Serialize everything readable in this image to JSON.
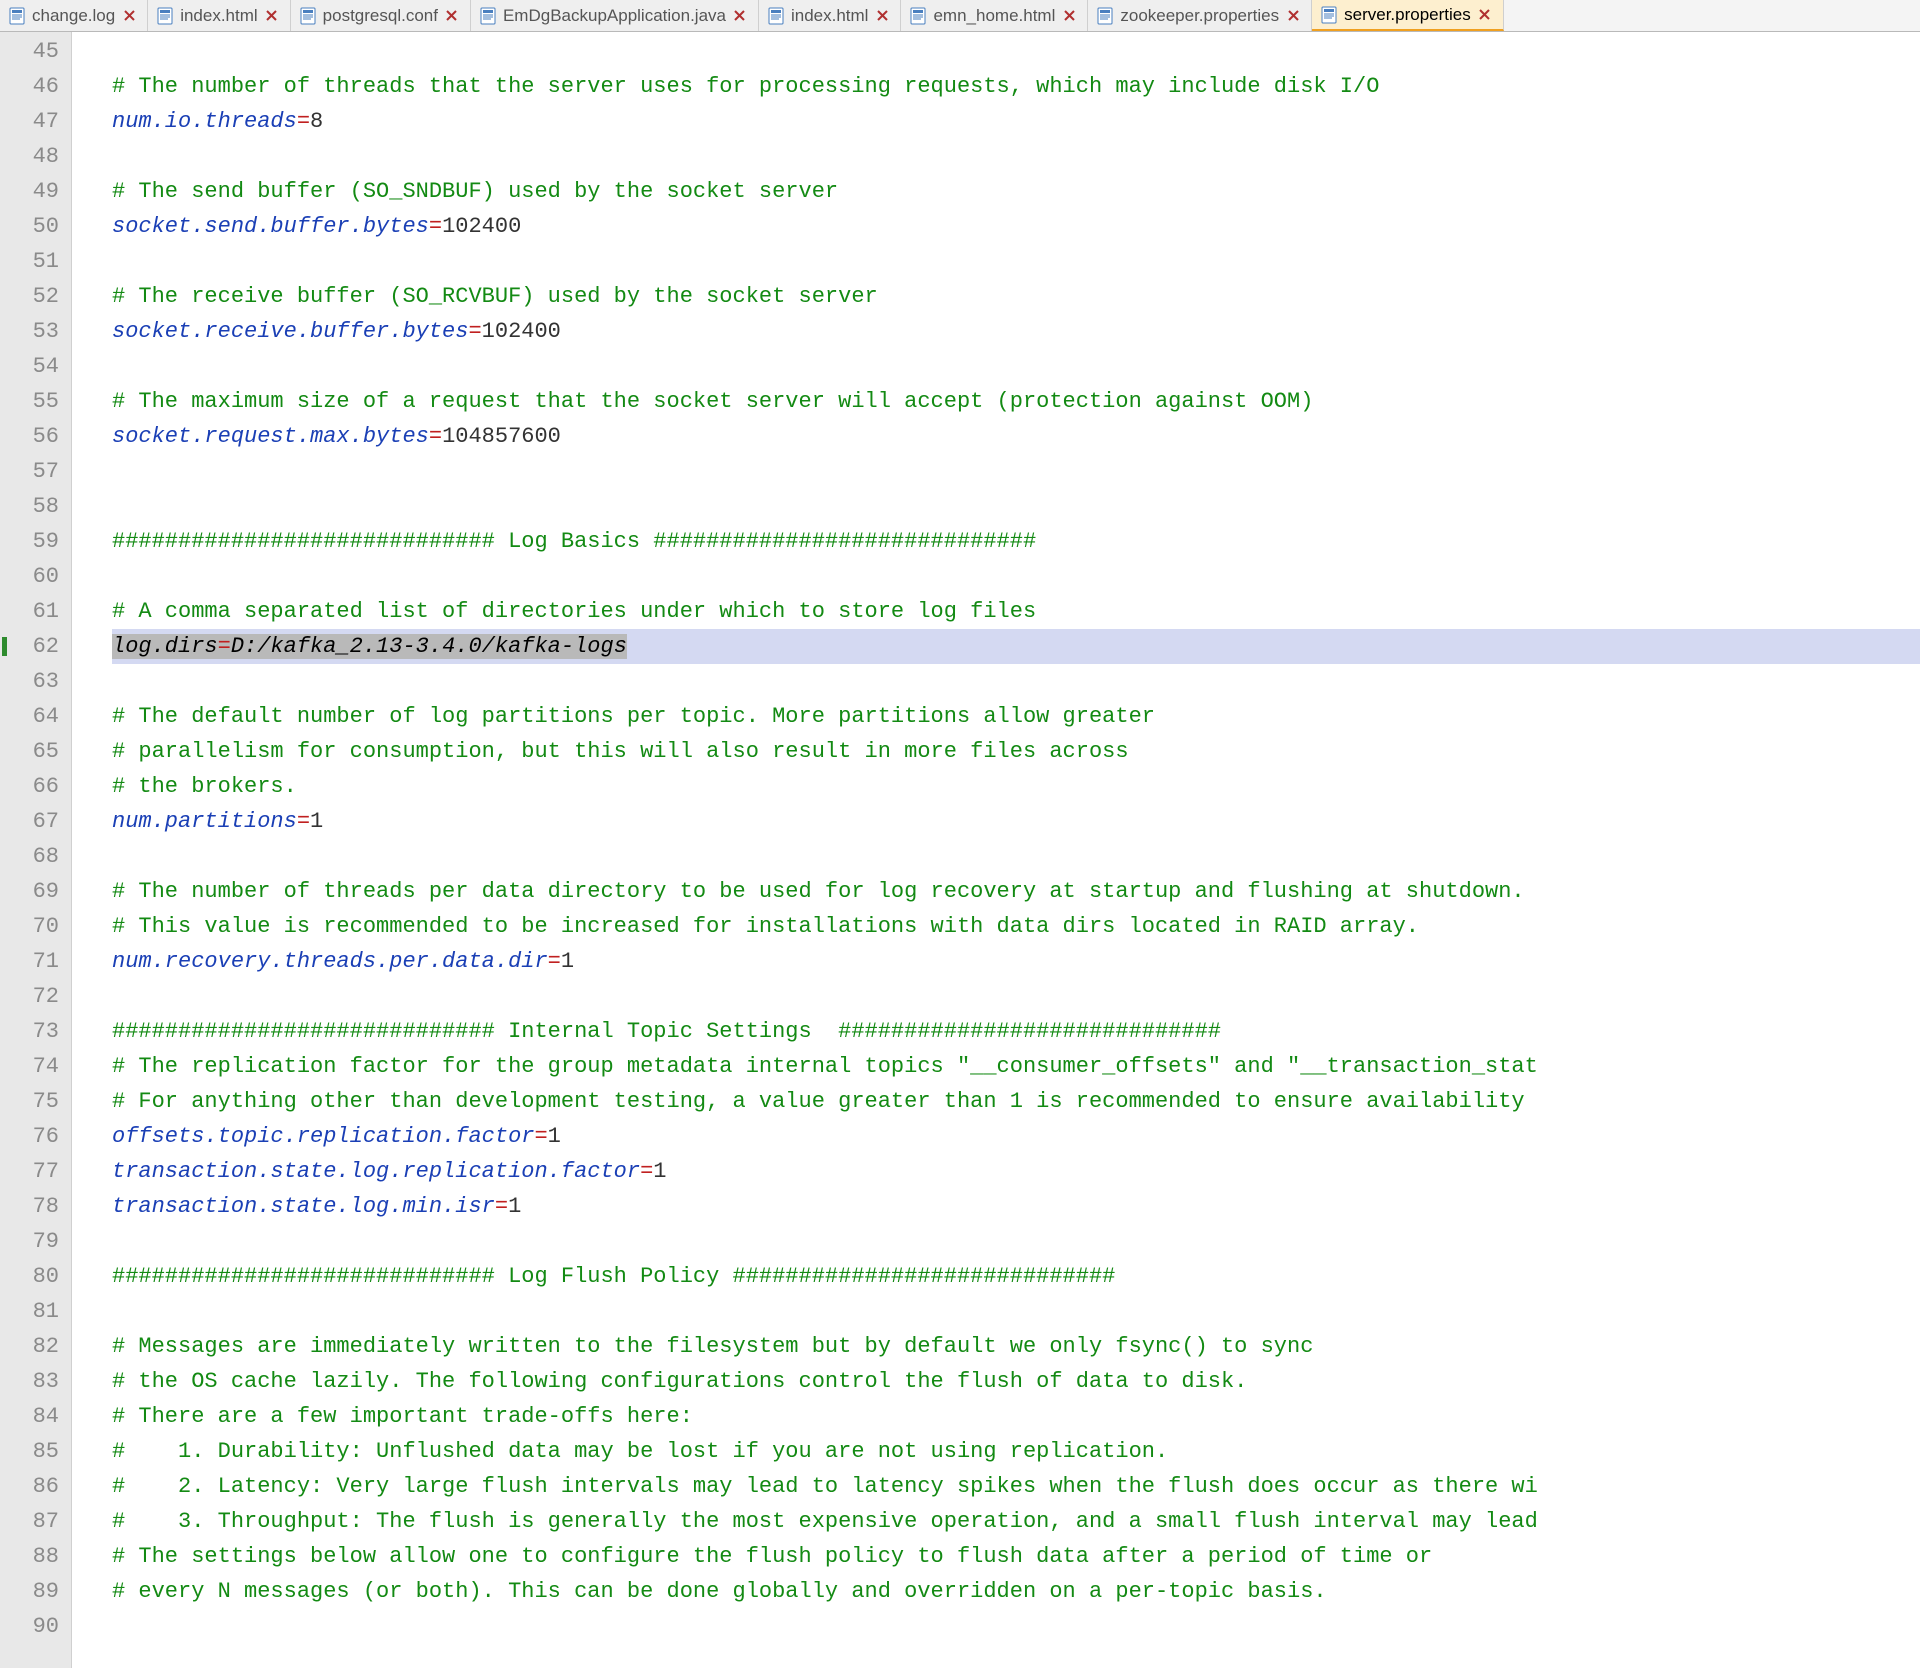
{
  "tabs": [
    {
      "label": "change.log",
      "active": false
    },
    {
      "label": "index.html",
      "active": false
    },
    {
      "label": "postgresql.conf",
      "active": false
    },
    {
      "label": "EmDgBackupApplication.java",
      "active": false
    },
    {
      "label": "index.html",
      "active": false
    },
    {
      "label": "emn_home.html",
      "active": false
    },
    {
      "label": "zookeeper.properties",
      "active": false
    },
    {
      "label": "server.properties",
      "active": true
    }
  ],
  "gutter": {
    "start": 45,
    "end": 90,
    "modified": [
      62
    ]
  },
  "code": {
    "45": {
      "type": "blank"
    },
    "46": {
      "type": "comment",
      "text": "# The number of threads that the server uses for processing requests, which may include disk I/O"
    },
    "47": {
      "type": "prop",
      "key": "num.io.threads",
      "value": "8"
    },
    "48": {
      "type": "blank"
    },
    "49": {
      "type": "comment",
      "text": "# The send buffer (SO_SNDBUF) used by the socket server"
    },
    "50": {
      "type": "prop",
      "key": "socket.send.buffer.bytes",
      "value": "102400"
    },
    "51": {
      "type": "blank"
    },
    "52": {
      "type": "comment",
      "text": "# The receive buffer (SO_RCVBUF) used by the socket server"
    },
    "53": {
      "type": "prop",
      "key": "socket.receive.buffer.bytes",
      "value": "102400"
    },
    "54": {
      "type": "blank"
    },
    "55": {
      "type": "comment",
      "text": "# The maximum size of a request that the socket server will accept (protection against OOM)"
    },
    "56": {
      "type": "prop",
      "key": "socket.request.max.bytes",
      "value": "104857600"
    },
    "57": {
      "type": "blank"
    },
    "58": {
      "type": "blank"
    },
    "59": {
      "type": "comment",
      "text": "############################# Log Basics #############################"
    },
    "60": {
      "type": "blank"
    },
    "61": {
      "type": "comment",
      "text": "# A comma separated list of directories under which to store log files"
    },
    "62": {
      "type": "prop",
      "key": "log.dirs",
      "value": "D:/kafka_2.13-3.4.0/kafka-logs",
      "highlighted": true,
      "selected": true
    },
    "63": {
      "type": "blank"
    },
    "64": {
      "type": "comment",
      "text": "# The default number of log partitions per topic. More partitions allow greater"
    },
    "65": {
      "type": "comment",
      "text": "# parallelism for consumption, but this will also result in more files across"
    },
    "66": {
      "type": "comment",
      "text": "# the brokers."
    },
    "67": {
      "type": "prop",
      "key": "num.partitions",
      "value": "1"
    },
    "68": {
      "type": "blank"
    },
    "69": {
      "type": "comment",
      "text": "# The number of threads per data directory to be used for log recovery at startup and flushing at shutdown."
    },
    "70": {
      "type": "comment",
      "text": "# This value is recommended to be increased for installations with data dirs located in RAID array."
    },
    "71": {
      "type": "prop",
      "key": "num.recovery.threads.per.data.dir",
      "value": "1"
    },
    "72": {
      "type": "blank"
    },
    "73": {
      "type": "comment",
      "text": "############################# Internal Topic Settings  #############################"
    },
    "74": {
      "type": "comment",
      "text": "# The replication factor for the group metadata internal topics \"__consumer_offsets\" and \"__transaction_stat"
    },
    "75": {
      "type": "comment",
      "text": "# For anything other than development testing, a value greater than 1 is recommended to ensure availability "
    },
    "76": {
      "type": "prop",
      "key": "offsets.topic.replication.factor",
      "value": "1"
    },
    "77": {
      "type": "prop",
      "key": "transaction.state.log.replication.factor",
      "value": "1"
    },
    "78": {
      "type": "prop",
      "key": "transaction.state.log.min.isr",
      "value": "1"
    },
    "79": {
      "type": "blank"
    },
    "80": {
      "type": "comment",
      "text": "############################# Log Flush Policy #############################"
    },
    "81": {
      "type": "blank"
    },
    "82": {
      "type": "comment",
      "text": "# Messages are immediately written to the filesystem but by default we only fsync() to sync"
    },
    "83": {
      "type": "comment",
      "text": "# the OS cache lazily. The following configurations control the flush of data to disk."
    },
    "84": {
      "type": "comment",
      "text": "# There are a few important trade-offs here:"
    },
    "85": {
      "type": "comment",
      "text": "#    1. Durability: Unflushed data may be lost if you are not using replication."
    },
    "86": {
      "type": "comment",
      "text": "#    2. Latency: Very large flush intervals may lead to latency spikes when the flush does occur as there wi"
    },
    "87": {
      "type": "comment",
      "text": "#    3. Throughput: The flush is generally the most expensive operation, and a small flush interval may lead"
    },
    "88": {
      "type": "comment",
      "text": "# The settings below allow one to configure the flush policy to flush data after a period of time or"
    },
    "89": {
      "type": "comment",
      "text": "# every N messages (or both). This can be done globally and overridden on a per-topic basis."
    },
    "90": {
      "type": "blank"
    }
  }
}
